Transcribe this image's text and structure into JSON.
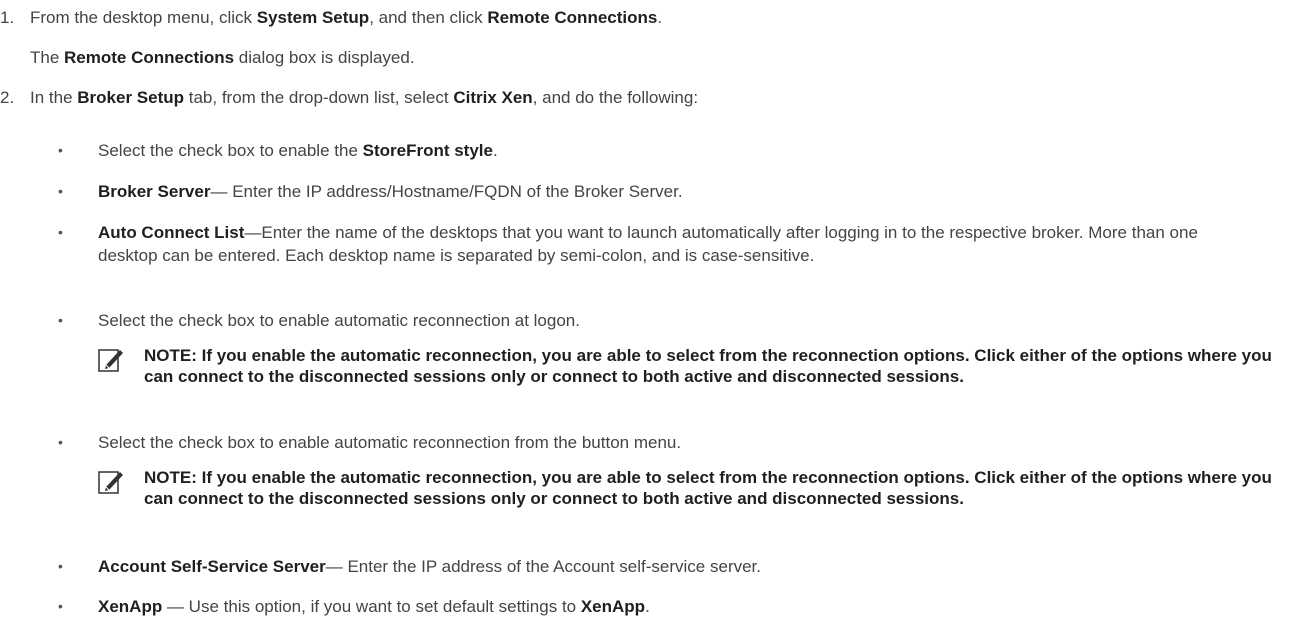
{
  "steps": [
    {
      "number": "1.",
      "parts": [
        "From the desktop menu, click ",
        "System Setup",
        ", and then click ",
        "Remote Connections",
        "."
      ],
      "result_parts": [
        "The ",
        "Remote Connections",
        " dialog box is displayed."
      ]
    },
    {
      "number": "2.",
      "parts": [
        "In the ",
        "Broker Setup",
        " tab, from the drop-down list, select ",
        "Citrix Xen",
        ", and do the following:"
      ]
    }
  ],
  "bullets": [
    {
      "prefix": "Select the check box to enable the ",
      "bold": "StoreFront style",
      "suffix": "."
    },
    {
      "bold": "Broker Server",
      "text": "— Enter the IP address/Hostname/FQDN of the Broker Server."
    },
    {
      "bold": "Auto Connect List",
      "text": "—Enter the name of the desktops that you want to launch automatically after logging in to the respective broker. More than one desktop can be entered. Each desktop name is separated by semi-colon, and is case-sensitive."
    },
    {
      "text": "Select the check box to enable automatic reconnection at logon."
    },
    {
      "text": "Select the check box to enable automatic reconnection from the button menu."
    },
    {
      "bold": "Account Self-Service Server",
      "text": "— Enter the IP address of the Account self-service server."
    },
    {
      "bold": "XenApp",
      "text": " — Use this option, if you want to set default settings to ",
      "bold2": "XenApp",
      "suffix": "."
    }
  ],
  "notes": [
    {
      "text": "NOTE: If you enable the automatic reconnection, you are able to select from the reconnection options. Click either of the options where you can connect to the disconnected sessions only or connect to both active and disconnected sessions."
    },
    {
      "text": "NOTE: If you enable the automatic reconnection, you are able to select from the reconnection options. Click either of the options where you can connect to the disconnected sessions only or connect to both active and disconnected sessions."
    }
  ],
  "bullet_glyph": "•",
  "icon_names": [
    "note-pencil-icon"
  ]
}
